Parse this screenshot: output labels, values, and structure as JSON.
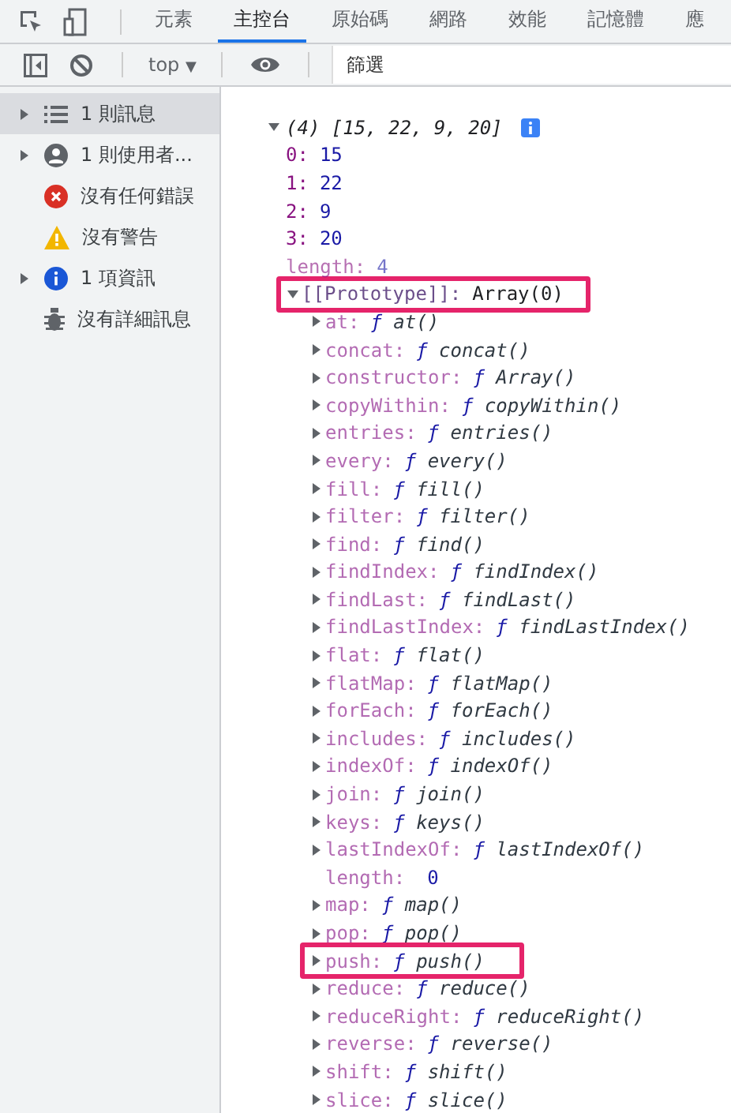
{
  "tabs": [
    {
      "label": "元素",
      "selected": false
    },
    {
      "label": "主控台",
      "selected": true
    },
    {
      "label": "原始碼",
      "selected": false
    },
    {
      "label": "網路",
      "selected": false
    },
    {
      "label": "效能",
      "selected": false
    },
    {
      "label": "記憶體",
      "selected": false
    },
    {
      "label": "應",
      "selected": false
    }
  ],
  "toolbar": {
    "context": "top",
    "context_caret": "▼",
    "filter": {
      "placeholder": "篩選"
    }
  },
  "sidebar": {
    "items": [
      {
        "label": "1 則訊息",
        "kind": "list",
        "expandable": true,
        "selected": true
      },
      {
        "label": "1 則使用者...",
        "kind": "user",
        "expandable": true,
        "selected": false
      },
      {
        "label": "沒有任何錯誤",
        "kind": "error",
        "expandable": false,
        "selected": false
      },
      {
        "label": "沒有警告",
        "kind": "warning",
        "expandable": false,
        "selected": false
      },
      {
        "label": "1 項資訊",
        "kind": "info",
        "expandable": true,
        "selected": false
      },
      {
        "label": "沒有詳細訊息",
        "kind": "bug",
        "expandable": false,
        "selected": false
      }
    ]
  },
  "console": {
    "header": {
      "count": "(4)",
      "preview": "[15, 22, 9, 20]",
      "expanded": true
    },
    "entries": [
      {
        "name": "0:",
        "value": "15",
        "enumerable": true
      },
      {
        "name": "1:",
        "value": "22",
        "enumerable": true
      },
      {
        "name": "2:",
        "value": "9",
        "enumerable": true
      },
      {
        "name": "3:",
        "value": "20",
        "enumerable": true
      },
      {
        "name": "length:",
        "value": "4",
        "enumerable": false
      }
    ],
    "prototype": {
      "name": "[[Prototype]]:",
      "value": "Array(0)",
      "expanded": true,
      "highlighted": true
    },
    "properties": [
      {
        "kind": "function",
        "name": "at:",
        "mark": "ƒ",
        "value": "at()",
        "highlighted": false
      },
      {
        "kind": "function",
        "name": "concat:",
        "mark": "ƒ",
        "value": "concat()",
        "highlighted": false
      },
      {
        "kind": "function",
        "name": "constructor:",
        "mark": "ƒ",
        "value": "Array()",
        "highlighted": false
      },
      {
        "kind": "function",
        "name": "copyWithin:",
        "mark": "ƒ",
        "value": "copyWithin()",
        "highlighted": false
      },
      {
        "kind": "function",
        "name": "entries:",
        "mark": "ƒ",
        "value": "entries()",
        "highlighted": false
      },
      {
        "kind": "function",
        "name": "every:",
        "mark": "ƒ",
        "value": "every()",
        "highlighted": false
      },
      {
        "kind": "function",
        "name": "fill:",
        "mark": "ƒ",
        "value": "fill()",
        "highlighted": false
      },
      {
        "kind": "function",
        "name": "filter:",
        "mark": "ƒ",
        "value": "filter()",
        "highlighted": false
      },
      {
        "kind": "function",
        "name": "find:",
        "mark": "ƒ",
        "value": "find()",
        "highlighted": false
      },
      {
        "kind": "function",
        "name": "findIndex:",
        "mark": "ƒ",
        "value": "findIndex()",
        "highlighted": false
      },
      {
        "kind": "function",
        "name": "findLast:",
        "mark": "ƒ",
        "value": "findLast()",
        "highlighted": false
      },
      {
        "kind": "function",
        "name": "findLastIndex:",
        "mark": "ƒ",
        "value": "findLastIndex()",
        "highlighted": false
      },
      {
        "kind": "function",
        "name": "flat:",
        "mark": "ƒ",
        "value": "flat()",
        "highlighted": false
      },
      {
        "kind": "function",
        "name": "flatMap:",
        "mark": "ƒ",
        "value": "flatMap()",
        "highlighted": false
      },
      {
        "kind": "function",
        "name": "forEach:",
        "mark": "ƒ",
        "value": "forEach()",
        "highlighted": false
      },
      {
        "kind": "function",
        "name": "includes:",
        "mark": "ƒ",
        "value": "includes()",
        "highlighted": false
      },
      {
        "kind": "function",
        "name": "indexOf:",
        "mark": "ƒ",
        "value": "indexOf()",
        "highlighted": false
      },
      {
        "kind": "function",
        "name": "join:",
        "mark": "ƒ",
        "value": "join()",
        "highlighted": false
      },
      {
        "kind": "function",
        "name": "keys:",
        "mark": "ƒ",
        "value": "keys()",
        "highlighted": false
      },
      {
        "kind": "function",
        "name": "lastIndexOf:",
        "mark": "ƒ",
        "value": "lastIndexOf()",
        "highlighted": false
      },
      {
        "kind": "number",
        "name": "length:",
        "value": "0",
        "highlighted": false
      },
      {
        "kind": "function",
        "name": "map:",
        "mark": "ƒ",
        "value": "map()",
        "highlighted": false
      },
      {
        "kind": "function",
        "name": "pop:",
        "mark": "ƒ",
        "value": "pop()",
        "highlighted": false
      },
      {
        "kind": "function",
        "name": "push:",
        "mark": "ƒ",
        "value": "push()",
        "highlighted": true
      },
      {
        "kind": "function",
        "name": "reduce:",
        "mark": "ƒ",
        "value": "reduce()",
        "highlighted": false
      },
      {
        "kind": "function",
        "name": "reduceRight:",
        "mark": "ƒ",
        "value": "reduceRight()",
        "highlighted": false
      },
      {
        "kind": "function",
        "name": "reverse:",
        "mark": "ƒ",
        "value": "reverse()",
        "highlighted": false
      },
      {
        "kind": "function",
        "name": "shift:",
        "mark": "ƒ",
        "value": "shift()",
        "highlighted": false
      },
      {
        "kind": "function",
        "name": "slice:",
        "mark": "ƒ",
        "value": "slice()",
        "highlighted": false
      }
    ]
  }
}
